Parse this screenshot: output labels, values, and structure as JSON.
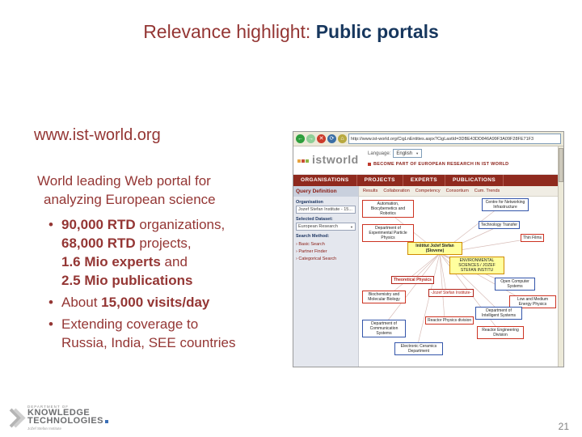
{
  "slide": {
    "title_prefix": "Relevance highlight: ",
    "title_emphasis": "Public portals",
    "page_number": "21",
    "bullet_char": "•"
  },
  "content": {
    "heading": "www.ist-world.org",
    "intro_line1": "World leading Web portal for",
    "intro_line2": "analyzing European science",
    "bullet1": {
      "l1b": "90,000 RTD",
      "l1r": " organizations,",
      "l2b": "68,000 RTD",
      "l2r": " projects,",
      "l3b": "1.6 Mio experts",
      "l3r": " and",
      "l4b": "2.5 Mio publications"
    },
    "bullet2": {
      "r": "About ",
      "b": "15,000 visits/day"
    },
    "bullet3": {
      "line1": "Extending coverage to",
      "line2": "Russia, India, SEE countries"
    }
  },
  "footer": {
    "dept_line1": "DEPARTMENT OF",
    "dept_line2": "KNOWLEDGE",
    "dept_line3": "TECHNOLOGIES",
    "dept_sub": "Jožef Stefan Institute"
  },
  "icons": {
    "back": "←",
    "forward": "→",
    "stop": "✕",
    "refresh": "⟳",
    "home": "⌂",
    "caret": "▼",
    "link_arrow": "›"
  },
  "screenshot": {
    "browser": {
      "url": "http://www.ist-world.org/CigLnEntities.aspx?CigLastId=3DBE43DD846A99F3A09F28FE71F3",
      "notice": "BECOME PART OF EUROPEAN RESEARCH IN IST WORLD"
    },
    "site": {
      "logo_text": "istworld",
      "language_label": "Language:",
      "language_value": "English",
      "nav": [
        "ORGANISATIONS",
        "PROJECTS",
        "EXPERTS",
        "PUBLICATIONS"
      ],
      "subnav": [
        "Results",
        "Collaboration",
        "Competency",
        "Consortium",
        "Cum. Trends"
      ]
    },
    "sidebar": {
      "query_header": "Query Definition",
      "organisation_label": "Organisation",
      "organisation_value": "Jozef Stefan Institute - 15...",
      "dataset_label": "Selected Dataset:",
      "dataset_value": "European Research",
      "method_label": "Search Method:",
      "links": [
        "Basic Search",
        "Partner Finder",
        "Categorical Search"
      ]
    },
    "graph": {
      "nodes": [
        {
          "label": "Automation, Biocybernetics and Robotics"
        },
        {
          "label": "Centre for Networking Infrastructure"
        },
        {
          "label": "Department of Experimental Particle Physics"
        },
        {
          "label": "Technology Transfer"
        },
        {
          "label": "Thin Films"
        },
        {
          "label": "Inštitut Jožef Stefan (Slovene)"
        },
        {
          "label": "ENVIRONMENTAL SCIENCES / JOZEF STEFAN INSTITU"
        },
        {
          "label": "Theoretical Physics"
        },
        {
          "label": "-Jozef Stefan Institute-"
        },
        {
          "label": "Open Computer Systems"
        },
        {
          "label": "Low and Medium Energy Physics"
        },
        {
          "label": "Department of Intelligent Systems"
        },
        {
          "label": "Reactor Physics division"
        },
        {
          "label": "Reactor Engineering Division"
        },
        {
          "label": "Electronic Ceramics Department"
        },
        {
          "label": "Biochemistry and Molecular Biology"
        },
        {
          "label": "Department of Communication Systems"
        }
      ]
    }
  },
  "colors": {
    "title_red": "#943634",
    "title_blue": "#17375e",
    "nav_red": "#8f2a1e",
    "highlight_yellow": "#ffff9e"
  }
}
